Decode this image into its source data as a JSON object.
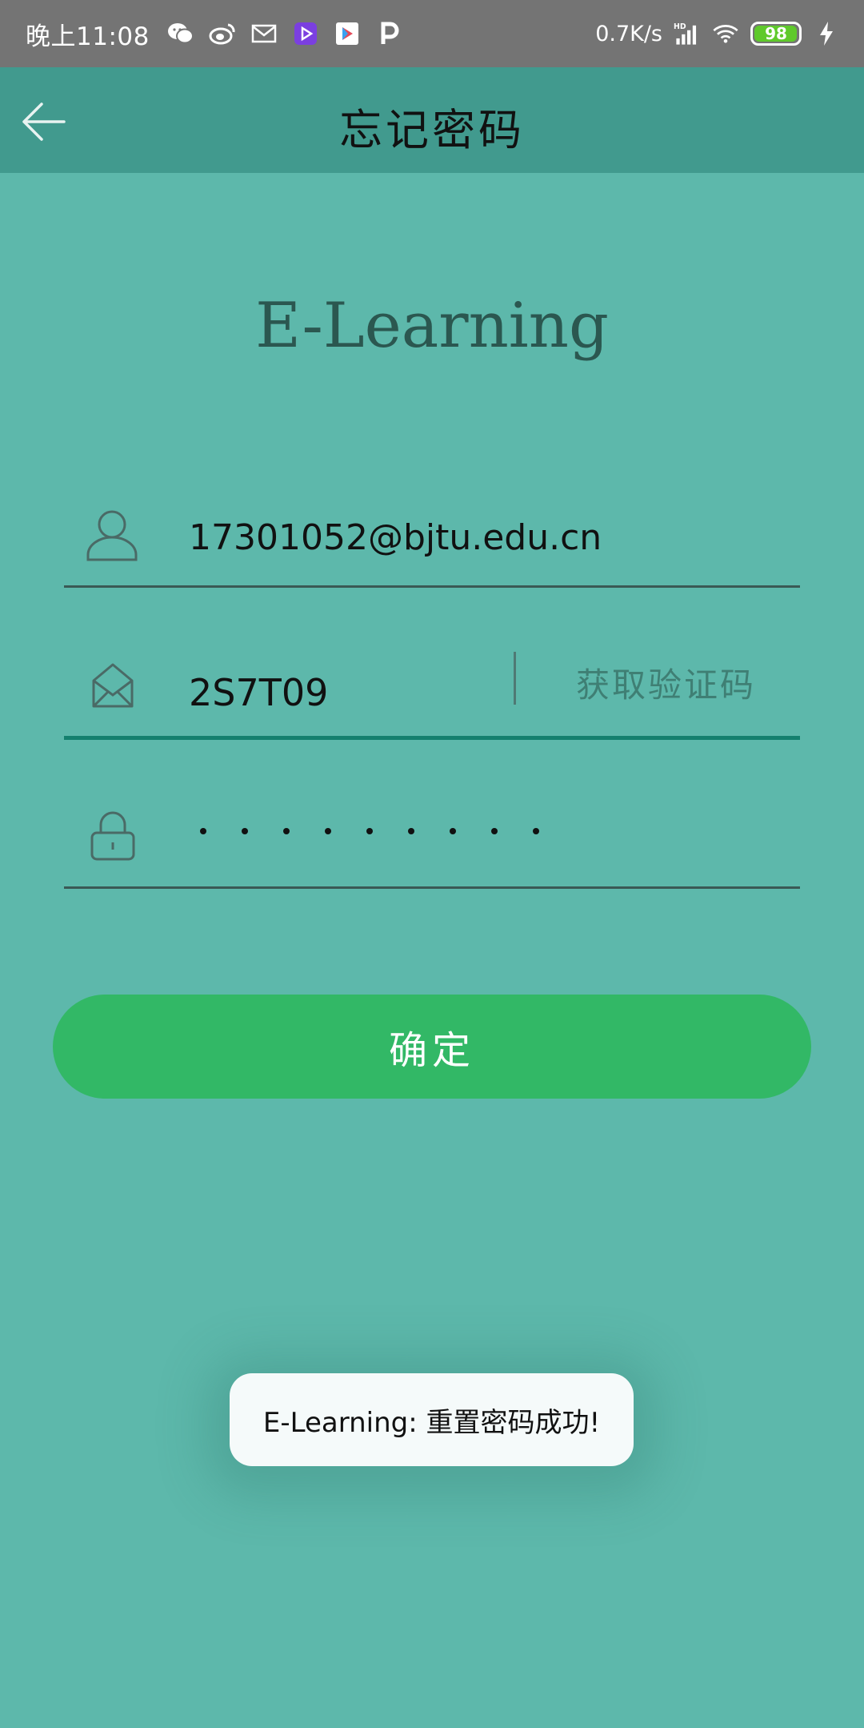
{
  "status_bar": {
    "time": "晚上11:08",
    "network_speed": "0.7K/s",
    "battery_level": "98",
    "icons": [
      "wechat-icon",
      "weibo-icon",
      "mail-icon",
      "video-app-icon",
      "play-store-icon",
      "p-app-icon",
      "hd-signal-icon",
      "wifi-icon",
      "charging-icon"
    ]
  },
  "app_bar": {
    "title": "忘记密码",
    "back_icon": "arrow-left-icon"
  },
  "logo": {
    "text": "E-Learning"
  },
  "form": {
    "email": {
      "value": "17301052@bjtu.edu.cn",
      "icon": "user-icon"
    },
    "code": {
      "value": "2S7T09",
      "icon": "envelope-icon",
      "get_code_label": "获取验证码"
    },
    "password": {
      "masked_length": 9,
      "icon": "lock-icon"
    },
    "confirm_label": "确定"
  },
  "toast": {
    "message": "E-Learning: 重置密码成功!"
  },
  "colors": {
    "background": "#5db8ab",
    "app_bar": "#419a8e",
    "status_bar": "#747474",
    "confirm_button": "#32b866",
    "focused_underline": "#14806e"
  }
}
